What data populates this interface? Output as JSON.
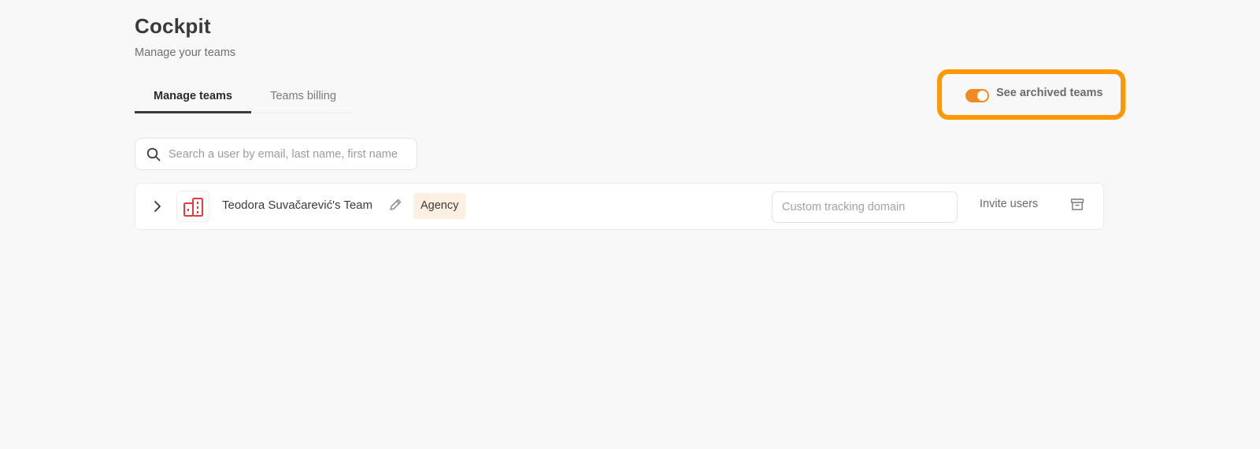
{
  "header": {
    "title": "Cockpit",
    "subtitle": "Manage your teams"
  },
  "tabs": [
    {
      "label": "Manage teams",
      "active": true
    },
    {
      "label": "Teams billing",
      "active": false
    }
  ],
  "archived_toggle": {
    "label": "See archived teams",
    "enabled": true,
    "accent_color": "#ef8a25",
    "highlight_color": "#ff9800"
  },
  "search": {
    "placeholder": "Search a user by email, last name, first name",
    "value": "",
    "icon": "search-icon"
  },
  "teams": [
    {
      "name": "Teodora Suvačarević's Team",
      "badge": "Agency",
      "logo_icon": "building-icon",
      "logo_color": "#e5393c",
      "tracking_domain_placeholder": "Custom tracking domain",
      "tracking_domain_value": "",
      "invite_label": "Invite users"
    }
  ]
}
